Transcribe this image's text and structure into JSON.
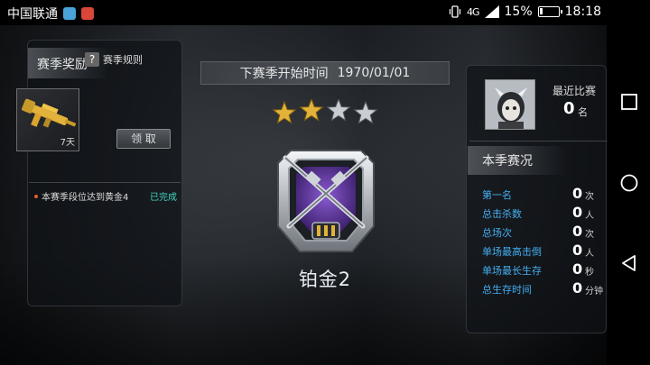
{
  "status_bar": {
    "carrier": "中国联通",
    "network": "4G",
    "battery": "15%",
    "battery_level": 0.15,
    "time": "18:18"
  },
  "left_panel": {
    "title": "赛季奖励",
    "rules_label": "赛季规则",
    "rules_icon": "?",
    "reward_days": "7天",
    "claim_label": "领 取",
    "task_text": "本赛季段位达到黄金4",
    "task_status": "已完成"
  },
  "center": {
    "season_label": "下赛季开始时间",
    "season_date": "1970/01/01",
    "stars_total": 4,
    "stars_filled": 2,
    "rank_name": "铂金2"
  },
  "right_panel": {
    "recent_label": "最近比赛",
    "recent_value": "0",
    "recent_unit": "名",
    "stats_title": "本季赛况",
    "stats": [
      {
        "label": "第一名",
        "value": "0",
        "unit": "次"
      },
      {
        "label": "总击杀数",
        "value": "0",
        "unit": "人"
      },
      {
        "label": "总场次",
        "value": "0",
        "unit": "次"
      },
      {
        "label": "单场最高击倒",
        "value": "0",
        "unit": "人"
      },
      {
        "label": "单场最长生存",
        "value": "0",
        "unit": "秒"
      },
      {
        "label": "总生存时间",
        "value": "0",
        "unit": "分钟"
      }
    ]
  },
  "colors": {
    "accent_blue": "#45aef0",
    "done_green": "#3fd6c2",
    "gold": "#e2b23a"
  },
  "icons": {
    "app1": "qq-browser-icon",
    "app2": "app-icon",
    "reward": "gold-rifle-icon",
    "emblem": "platinum-crossed-rifles-emblem"
  }
}
